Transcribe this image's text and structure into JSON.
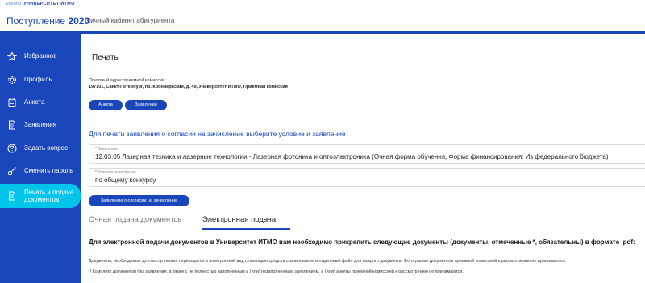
{
  "topbar": {
    "logo_mark": "ИФМО",
    "logo_text": "УНИВЕРСИТЕТ ИТМО"
  },
  "header": {
    "brand_prefix": "Поступление",
    "brand_year": "2020",
    "cabinet": "Личный кабинет абитуриента"
  },
  "sidebar": {
    "items": [
      {
        "label": "Избранное",
        "icon": "star-icon"
      },
      {
        "label": "Профиль",
        "icon": "gear-icon"
      },
      {
        "label": "Анкета",
        "icon": "clipboard-icon"
      },
      {
        "label": "Заявления",
        "icon": "document-icon"
      },
      {
        "label": "Задать вопрос",
        "icon": "question-icon"
      },
      {
        "label": "Сменить пароль",
        "icon": "key-icon"
      },
      {
        "label": "Печать и подача документов",
        "icon": "print-document-icon",
        "active": true
      }
    ]
  },
  "main": {
    "title": "Печать",
    "address_label": "Почтовый адрес приемной комиссии:",
    "address_value": "197101, Санкт-Петербург, пр. Кронверкский, д. 49, Университет ИТМО, Приёмная комиссия",
    "btn_anketa": "Анкета",
    "btn_zayavlenie": "Заявление",
    "consent_text": "Для печати заявления о согласии на зачисление выберите условие и заявление",
    "field_application": {
      "label": "Заявление",
      "value": "12.03.05 Лазерная техника и лазерные технологии - Лазерная фотоника и оптоэлектроника (Очная форма обучения, Форма финансирования: Из федерального бюджета)"
    },
    "field_condition": {
      "label": "Условие зачисления",
      "value": "по общему конкурсу"
    },
    "btn_consent": "Заявление о согласии на зачисление",
    "tabs": {
      "paper": "Очная подача документов",
      "electronic": "Электронная подача"
    },
    "notice": "Для электронной подачи документов в Университет ИТМО вам необходимо прикрепить следующие документы (документы, отмеченные *, обязательны) в формате .pdf:",
    "para1": "Документы, необходимые для поступления, переводятся в электронный вид с помощью средств сканирования в отдельный файл для каждого документа. Фотографии документов приемной комиссией к рассмотрению не принимаются.",
    "para2": "!! Комплект документов без заявления, а также с не полностью заполненным и (или) незаполненным заявлением, и (или) анкеты приемной комиссией к рассмотрению не принимаются."
  },
  "colors": {
    "brand_blue": "#1946ba",
    "active_cyan": "#00c5ea"
  }
}
